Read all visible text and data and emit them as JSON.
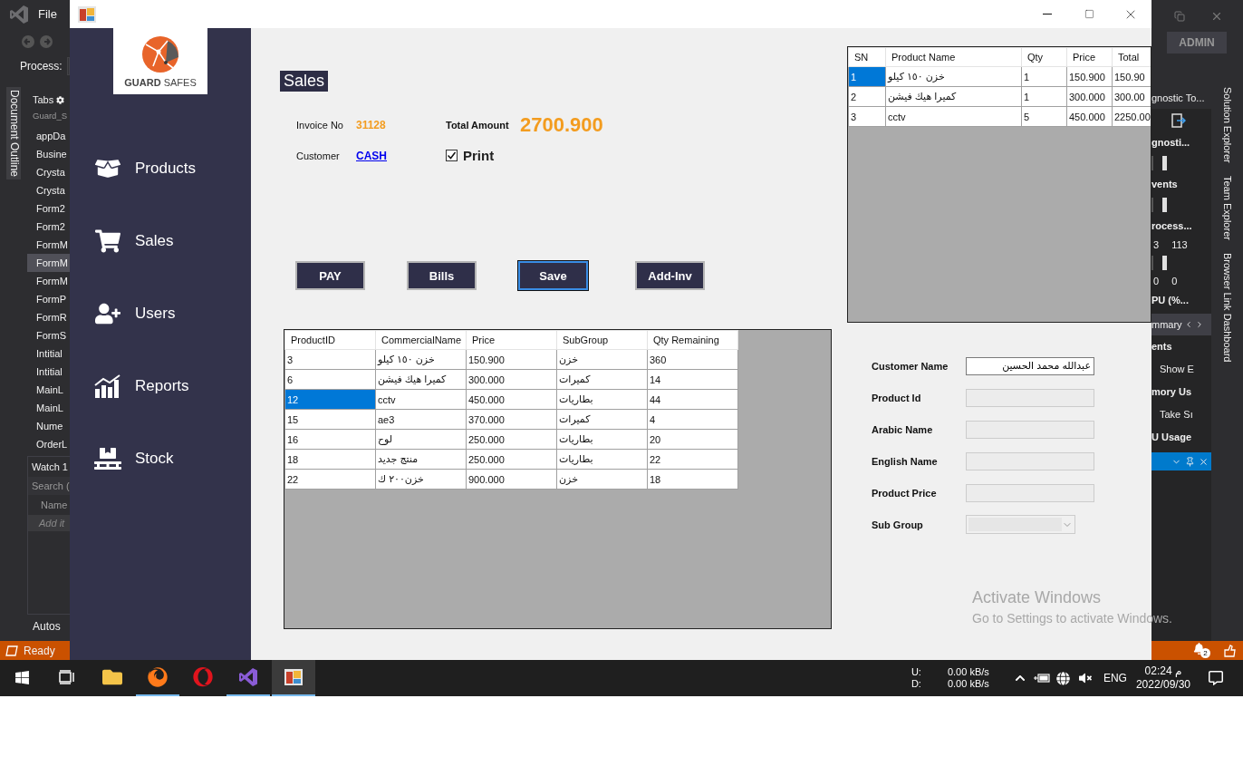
{
  "ide": {
    "menu": "File",
    "process_label": "Process:",
    "side_tab": "Document Outline",
    "explorer": {
      "title": "Tabs",
      "root": "Guard_S",
      "items": [
        {
          "label": "appDa",
          "selected": false
        },
        {
          "label": "Busine",
          "selected": false
        },
        {
          "label": "Crysta",
          "selected": false
        },
        {
          "label": "Crysta",
          "selected": false
        },
        {
          "label": "Form2",
          "selected": false
        },
        {
          "label": "Form2",
          "selected": false
        },
        {
          "label": "FormM",
          "selected": false
        },
        {
          "label": "FormM",
          "selected": true
        },
        {
          "label": "FormM",
          "selected": false
        },
        {
          "label": "FormP",
          "selected": false
        },
        {
          "label": "FormR",
          "selected": false
        },
        {
          "label": "FormS",
          "selected": false
        },
        {
          "label": "Intitial",
          "selected": false
        },
        {
          "label": "Intitial",
          "selected": false
        },
        {
          "label": "MainL",
          "selected": false
        },
        {
          "label": "MainL",
          "selected": false
        },
        {
          "label": "Nume",
          "selected": false
        },
        {
          "label": "OrderL",
          "selected": false
        }
      ]
    },
    "watch": {
      "title": "Watch 1",
      "search": "Search (",
      "column": "Name",
      "add_row": "Add it"
    },
    "bottom_tab": "Autos",
    "status": "Ready",
    "account": "ADMIN",
    "diag_rows": [
      {
        "kind": "title",
        "text": "gnostic To..."
      },
      {
        "kind": "toolbar"
      },
      {
        "kind": "header",
        "text": "gnosti..."
      },
      {
        "kind": "graph"
      },
      {
        "kind": "header",
        "text": "vents"
      },
      {
        "kind": "graph"
      },
      {
        "kind": "header",
        "text": "rocess..."
      },
      {
        "kind": "pair",
        "cells": [
          "3",
          "113"
        ]
      },
      {
        "kind": "graph"
      },
      {
        "kind": "pair",
        "cells": [
          "0",
          "0"
        ]
      },
      {
        "kind": "header",
        "text": "PU (%..."
      },
      {
        "kind": "tabs",
        "text": "mmary"
      },
      {
        "kind": "header",
        "text": "ents"
      },
      {
        "kind": "text",
        "text": "Show E"
      },
      {
        "kind": "header",
        "text": "mory Us"
      },
      {
        "kind": "text",
        "text": "Take Sı"
      },
      {
        "kind": "header",
        "text": "U Usage"
      },
      {
        "kind": "panelbar"
      }
    ],
    "vertical_tabs": [
      "Solution Explorer",
      "Team Explorer",
      "Browser Link Dashboard"
    ],
    "notifications": "2"
  },
  "window": {
    "logo": {
      "bold": "GUARD",
      "light": "SAFES"
    },
    "nav": [
      {
        "label": "Products",
        "kind": "box"
      },
      {
        "label": "Sales",
        "kind": "cart"
      },
      {
        "label": "Users",
        "kind": "user"
      },
      {
        "label": "Reports",
        "kind": "chart"
      },
      {
        "label": "Stock",
        "kind": "pallet"
      }
    ],
    "sales": {
      "title": "Sales",
      "invoice_label": "Invoice No",
      "invoice_no": "31128",
      "total_label": "Total Amount",
      "total": "2700.900",
      "customer_label": "Customer",
      "customer": "CASH",
      "print": {
        "label": "Print",
        "checked": true
      }
    },
    "buttons": [
      {
        "label": "PAY",
        "selected": false
      },
      {
        "label": "Bills",
        "selected": false
      },
      {
        "label": "Save",
        "selected": true
      },
      {
        "label": "Add-Inv",
        "selected": false
      }
    ],
    "cart": {
      "columns": [
        "SN",
        "Product Name",
        "Qty",
        "Price",
        "Total"
      ],
      "rows": [
        {
          "cells": [
            "1",
            "خزن ١٥٠ كيلو",
            "1",
            "150.900",
            "150.90"
          ],
          "selected": true
        },
        {
          "cells": [
            "2",
            "كميرا هيك فيشن",
            "1",
            "300.000",
            "300.00"
          ],
          "selected": false
        },
        {
          "cells": [
            "3",
            "cctv",
            "5",
            "450.000",
            "2250.00"
          ],
          "selected": false
        }
      ]
    },
    "products": {
      "columns": [
        "ProductID",
        "CommercialName",
        "Price",
        "SubGroup",
        "Qty Remaining"
      ],
      "rows": [
        {
          "cells": [
            "3",
            "خزن ١٥٠ كيلو",
            "150.900",
            "خزن",
            "360"
          ],
          "selected": false
        },
        {
          "cells": [
            "6",
            "كميرا هيك فيشن",
            "300.000",
            "كميرات",
            "14"
          ],
          "selected": false
        },
        {
          "cells": [
            "12",
            "cctv",
            "450.000",
            "بطاريات",
            "44"
          ],
          "selected": true
        },
        {
          "cells": [
            "15",
            "ae3",
            "370.000",
            "كميرات",
            "4"
          ],
          "selected": false
        },
        {
          "cells": [
            "16",
            "لوح",
            "250.000",
            "بطاريات",
            "20"
          ],
          "selected": false
        },
        {
          "cells": [
            "18",
            "منتج جديد",
            "250.000",
            "بطاريات",
            "22"
          ],
          "selected": false
        },
        {
          "cells": [
            "22",
            "خزن٢٠٠ ك",
            "900.000",
            "خزن",
            "18"
          ],
          "selected": false
        }
      ]
    },
    "form": [
      {
        "label": "Customer Name",
        "kind": "text",
        "value": "عبدالله محمد الحسين",
        "disabled": false
      },
      {
        "label": "Product Id",
        "kind": "text",
        "disabled": true
      },
      {
        "label": "Arabic Name",
        "kind": "text",
        "disabled": true
      },
      {
        "label": "English Name",
        "kind": "text",
        "disabled": true
      },
      {
        "label": "Product Price",
        "kind": "text",
        "disabled": true
      },
      {
        "label": "Sub Group",
        "kind": "select",
        "disabled": true
      }
    ],
    "activation": {
      "title": "Activate Windows",
      "hint": "Go to Settings to activate Windows."
    }
  },
  "taskbar": {
    "apps": [
      {
        "kind": "start",
        "running": false,
        "selected": false
      },
      {
        "kind": "taskview",
        "running": false,
        "selected": false
      },
      {
        "kind": "folder",
        "running": false,
        "selected": false
      },
      {
        "kind": "firefox",
        "running": true,
        "selected": false
      },
      {
        "kind": "opera",
        "running": false,
        "selected": false
      },
      {
        "kind": "studio",
        "running": true,
        "selected": false
      },
      {
        "kind": "app",
        "running": true,
        "selected": true
      }
    ],
    "net": [
      {
        "label": "U:",
        "rate": "0.00 kB/s"
      },
      {
        "label": "D:",
        "rate": "0.00 kB/s"
      }
    ],
    "language": "ENG",
    "time": "02:24 م",
    "date": "2022/09/30"
  }
}
